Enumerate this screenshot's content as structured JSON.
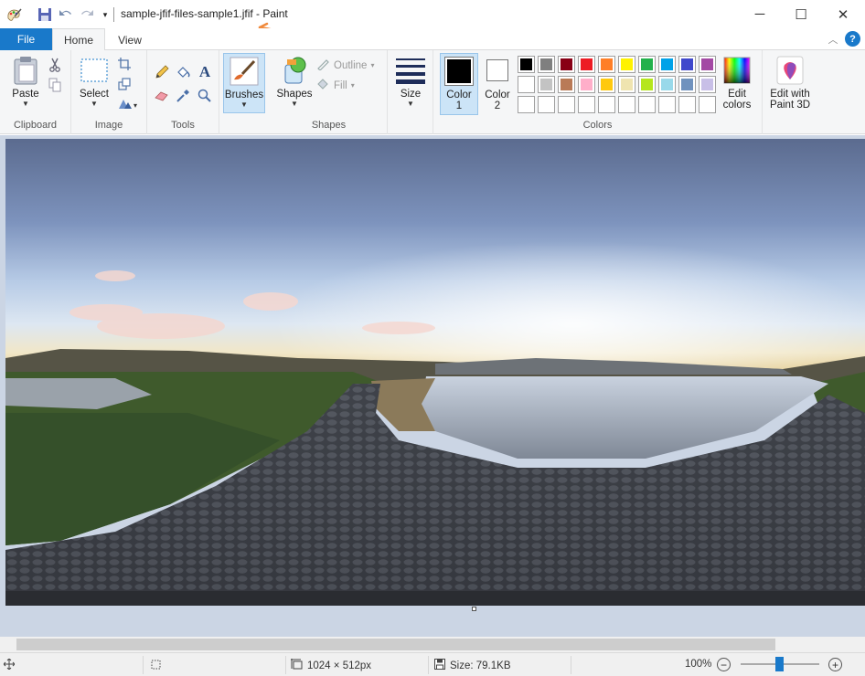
{
  "window": {
    "title": "sample-jfif-files-sample1.jfif - Paint",
    "minimize": "─",
    "maximize": "☐",
    "close": "✕"
  },
  "quick_access": {
    "icons": [
      "paint-app-icon",
      "save-icon",
      "undo-icon",
      "redo-icon",
      "customize-dropdown-icon"
    ]
  },
  "tabs": {
    "file": "File",
    "home": "Home",
    "view": "View"
  },
  "ribbon": {
    "clipboard": {
      "label": "Clipboard",
      "paste": "Paste"
    },
    "image": {
      "label": "Image",
      "select": "Select"
    },
    "tools": {
      "label": "Tools"
    },
    "brushes": {
      "label": "Brushes"
    },
    "shapes": {
      "label": "Shapes",
      "shapes_btn": "Shapes",
      "outline": "Outline",
      "fill": "Fill"
    },
    "size": {
      "label": "Size"
    },
    "colors": {
      "label": "Colors",
      "color1": "Color 1",
      "color1_line1": "Color",
      "color1_line2": "1",
      "color2_line1": "Color",
      "color2_line2": "2",
      "edit_colors_line1": "Edit",
      "edit_colors_line2": "colors",
      "color1_value": "#000000",
      "color2_value": "#ffffff",
      "palette_row1": [
        "#000000",
        "#7f7f7f",
        "#880015",
        "#ed1c24",
        "#ff7f27",
        "#fff200",
        "#22b14c",
        "#00a2e8",
        "#3f48cc",
        "#a349a4"
      ],
      "palette_row2": [
        "#ffffff",
        "#c3c3c3",
        "#b97a57",
        "#ffaec9",
        "#ffc90e",
        "#efe4b0",
        "#b5e61d",
        "#99d9ea",
        "#7092be",
        "#c8bfe7"
      ],
      "palette_row3": [
        "#ffffff",
        "#ffffff",
        "#ffffff",
        "#ffffff",
        "#ffffff",
        "#ffffff",
        "#ffffff",
        "#ffffff",
        "#ffffff",
        "#ffffff"
      ]
    },
    "paint3d": {
      "line1": "Edit with",
      "line2": "Paint 3D"
    }
  },
  "status": {
    "dimensions": "1024 × 512px",
    "size": "Size: 79.1KB",
    "zoom": "100%",
    "zoom_out": "−",
    "zoom_in": "+"
  },
  "accent": "#1979ca",
  "annotation_color": "#f08a3c"
}
